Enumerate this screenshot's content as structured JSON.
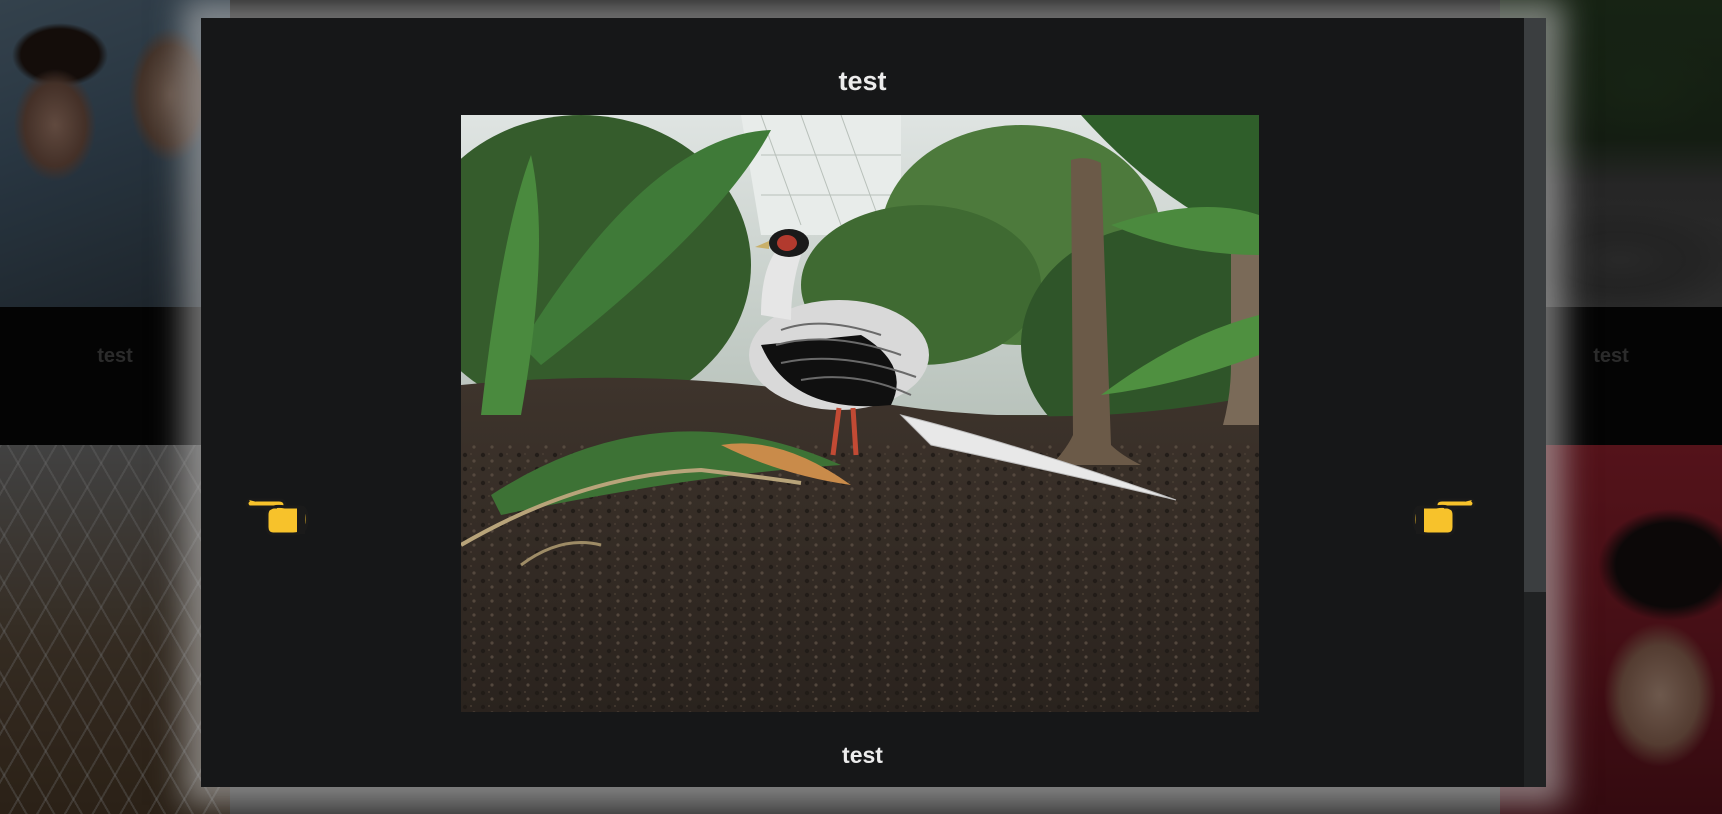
{
  "background": {
    "tiles": [
      {
        "label": "test",
        "position": "left"
      },
      {
        "label": "test",
        "position": "right"
      }
    ]
  },
  "lightbox": {
    "title": "test",
    "caption": "test",
    "image_alt": "Silver pheasant standing on soil among tropical plants"
  },
  "icons": {
    "prev": "hand-pointing-left-icon",
    "next": "hand-pointing-right-icon"
  },
  "colors": {
    "lightbox_bg": "#161718",
    "title_text": "#ececec",
    "hand_yellow": "#f7c22b"
  }
}
